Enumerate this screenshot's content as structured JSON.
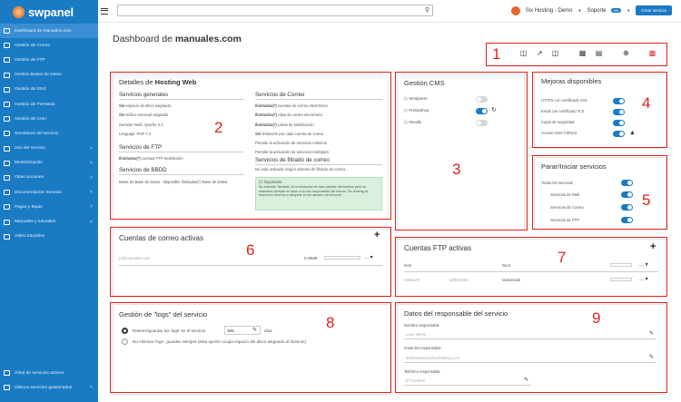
{
  "app": {
    "name": "swpanel"
  },
  "topbar": {
    "search_placeholder": "",
    "account": "Six Hosting - Demo",
    "support": "Soporte",
    "support_badge": "99+",
    "new_button": "Crear servicio"
  },
  "sidebar": {
    "items": [
      {
        "label": "Dashboard de manuales.com",
        "active": true
      },
      {
        "label": "Gestión de Correo"
      },
      {
        "label": "Gestión de FTP"
      },
      {
        "label": "Gestión Bases de Datos"
      },
      {
        "label": "Gestión de DNS"
      },
      {
        "label": "Gestión de Permisos"
      },
      {
        "label": "Gestión de Cron"
      },
      {
        "label": "Servidores del servicio"
      },
      {
        "label": "Uso del servicio"
      },
      {
        "label": "Monitorización"
      },
      {
        "label": "Otras acciones"
      },
      {
        "label": "Documentación Servicio"
      },
      {
        "label": "Pagos y Bajas"
      },
      {
        "label": "Manuales y tutoriales"
      },
      {
        "label": "Vídeo tutoriales"
      }
    ],
    "bottom": [
      {
        "label": "Árbol de servicios activos"
      },
      {
        "label": "Últimos servicios gestionados"
      }
    ]
  },
  "page": {
    "title_prefix": "Dashboard de ",
    "title_domain": "manuales.com"
  },
  "numbers": [
    "1",
    "2",
    "3",
    "4",
    "5",
    "6",
    "7",
    "8",
    "9"
  ],
  "hosting": {
    "title_prefix": "Detalles de ",
    "title_bold": "Hosting Web",
    "general_title": "Servicios generales",
    "general": [
      {
        "bold": "Sin",
        "text": " espacio de disco asignado"
      },
      {
        "bold": "Sin",
        "text": " tráfico mensual asignado"
      },
      {
        "bold": "",
        "text": "Servidor Web: Apache 2.4"
      },
      {
        "bold": "",
        "text": "Lenguaje: PHP 7.4"
      }
    ],
    "ftp_title": "Servicios de FTP",
    "ftp": [
      {
        "bold": "Ilimitadas(*)",
        "text": " cuentas FTP multisesión"
      }
    ],
    "bbdd_title": "Servicios de BBDD",
    "bbdd": [
      {
        "bold": "",
        "text": "Motor de Base de Datos : disponible Ilimitadas(*) Base de Datos"
      }
    ],
    "mail_title": "Servicios de Correo",
    "mail": [
      {
        "bold": "Ilimitadas(*)",
        "text": " cuentas de correo electrónico"
      },
      {
        "bold": "Ilimitados(*)",
        "text": " Alias de correo electrónico"
      },
      {
        "bold": "Ilimitadas(*)",
        "text": " Listas de Distribución"
      },
      {
        "bold": "Sin",
        "text": " limitación por cada cuenta de correo"
      },
      {
        "bold": "",
        "text": "Permite la activación de servicios Antivirus"
      },
      {
        "bold": "",
        "text": "Permite la activación de servicios AntiSpam"
      }
    ],
    "filter_title": "Servicios de filtrado de correo",
    "filter": [
      {
        "bold": "",
        "text": "No está activado ningún sistema de filtrado de correo."
      }
    ],
    "important_title": "(*) Importante",
    "important_text": "Se entiende 'ilimitado' la no limitación de esta variable del servicio pero se establece siempre en base a un uso responsable del mismo. Six Hosting se reserva el derecho a bloquear el uso abusivo del servicio."
  },
  "cms": {
    "title": "Gestión CMS",
    "items": [
      {
        "name": "Wordpress",
        "on": false,
        "icon": "wordpress-icon"
      },
      {
        "name": "PrestaShop",
        "on": true,
        "icon": "prestashop-icon"
      },
      {
        "name": "Moodle",
        "on": false,
        "icon": "moodle-icon"
      }
    ]
  },
  "improvements": {
    "title": "Mejoras disponibles",
    "items": [
      {
        "label": "HTTPS con certificado SSL",
        "on": true
      },
      {
        "label": "Email con certificado TLS",
        "on": true
      },
      {
        "label": "Copia de seguridad",
        "on": true
      },
      {
        "label": "Acceso SSH ChRoot",
        "on": true
      }
    ]
  },
  "services": {
    "title": "Parar/Iniciar servicios",
    "all_label": "Todos los servicios",
    "items": [
      {
        "label": "Servicios de Web",
        "on": true
      },
      {
        "label": "Servicios de Correo",
        "on": true
      },
      {
        "label": "Servicios de FTP",
        "on": true
      }
    ]
  },
  "mailaccounts": {
    "title": "Cuentas de correo activas",
    "rows": [
      {
        "email": "jv@manuales.com",
        "size": "0.00MB"
      }
    ]
  },
  "ftpaccounts": {
    "title": "Cuentas FTP activas",
    "header_user": "/test",
    "header_path": "Root",
    "rows": [
      {
        "user": "mb8au78",
        "pass": "a6fhb1E83",
        "path": "/datos/web"
      }
    ]
  },
  "logs": {
    "title": "Gestión de \"logs\" del servicio",
    "option1": "Retener/guardar los 'logs' en el servicio",
    "days_value": "365",
    "days_suffix": "días",
    "option2": "No eliminar 'logs', guardar siempre (esta opción ocupa espacio del disco asignado al dominio)"
  },
  "responsible": {
    "title": "Datos del responsable del servicio",
    "fields": [
      {
        "label": "Nombre responsable",
        "value": "Lupe Martin"
      },
      {
        "label": "email del responsable",
        "value": "administracion@swhosting.com"
      },
      {
        "label": "Teléfono responsable",
        "value": "877415566"
      }
    ]
  }
}
